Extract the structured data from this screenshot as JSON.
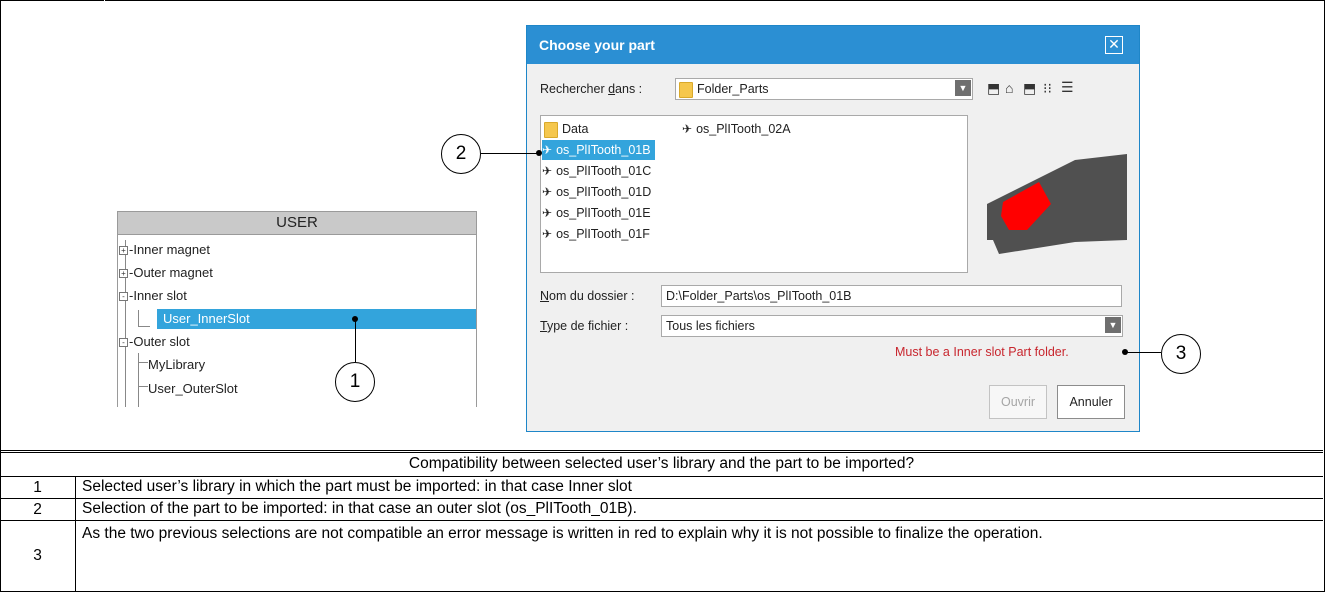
{
  "user_panel": {
    "header": "USER",
    "items": [
      {
        "label": "Inner magnet",
        "expander": "+"
      },
      {
        "label": "Outer magnet",
        "expander": "+"
      },
      {
        "label": "Inner slot",
        "expander": "-"
      },
      {
        "label": "User_InnerSlot"
      },
      {
        "label": "Outer slot",
        "expander": "-"
      },
      {
        "label": "MyLibrary"
      },
      {
        "label": "User_OuterSlot"
      }
    ]
  },
  "dialog": {
    "title": "Choose your part",
    "look_in_label_pre": "Rechercher ",
    "look_in_label_u": "d",
    "look_in_label_post": "ans :",
    "look_in_value": "Folder_Parts",
    "files": [
      {
        "name": "Data",
        "icon": "folder-icon"
      },
      {
        "name": "os_PlITooth_01B",
        "icon": "part-icon"
      },
      {
        "name": "os_PlITooth_01C",
        "icon": "part-icon"
      },
      {
        "name": "os_PlITooth_01D",
        "icon": "part-icon"
      },
      {
        "name": "os_PlITooth_01E",
        "icon": "part-icon"
      },
      {
        "name": "os_PlITooth_01F",
        "icon": "part-icon"
      },
      {
        "name": "os_PlITooth_02A",
        "icon": "part-icon"
      }
    ],
    "folder_name_label_u": "N",
    "folder_name_label_post": "om du dossier :",
    "folder_name_value": "D:\\Folder_Parts\\os_PlITooth_01B",
    "file_type_label_u": "T",
    "file_type_label_post": "ype de fichier :",
    "file_type_value": "Tous les fichiers",
    "error_message": "Must be a Inner slot Part folder.",
    "open_button": "Ouvrir",
    "cancel_button": "Annuler",
    "colors": {
      "title_bar": "#2b8fd3",
      "selection": "#33a4dc",
      "error": "#c8262e",
      "preview_slot": "#ff0000",
      "preview_body": "#505050"
    }
  },
  "callouts": [
    "1",
    "2",
    "3"
  ],
  "table": {
    "header": "Compatibility between selected user’s library and the part to be imported?",
    "rows": [
      {
        "num": "1",
        "text": "Selected user’s library in which the part must be imported: in that case Inner slot"
      },
      {
        "num": "2",
        "text": "Selection of the part to be imported: in that case an outer slot (os_PlITooth_01B)."
      },
      {
        "num": "3",
        "text": "As the two previous selections are not compatible an error message is written in red to explain why it is not possible to finalize the operation."
      }
    ]
  }
}
